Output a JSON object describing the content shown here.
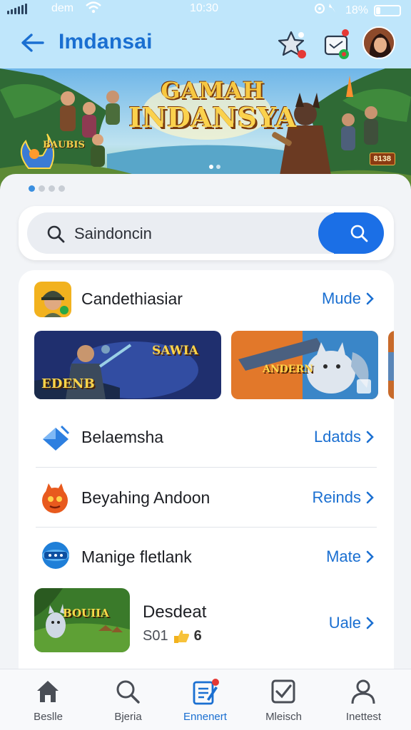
{
  "status_bar": {
    "carrier": "dem",
    "time": "10:30",
    "battery": "18%",
    "battery_level": 0.18
  },
  "header": {
    "title": "Imdansai",
    "icons": [
      "back-arrow-icon",
      "star-icon",
      "app-window-icon"
    ]
  },
  "banner": {
    "title_line1": "GAMAH",
    "title_line2": "INDANSYA",
    "left_label": "BAUBIS",
    "right_badge": "8138"
  },
  "carousel": {
    "total": 4,
    "active": 0
  },
  "search": {
    "value": "Saindoncin"
  },
  "sections": [
    {
      "label": "Candethiasiar",
      "link": "Mude",
      "icon": "soldier-app-icon"
    },
    {
      "label": "Belaemsha",
      "link": "Ldatds",
      "icon": "blue-diamond-icon"
    },
    {
      "label": "Beyahing Andoon",
      "link": "Reinds",
      "icon": "fire-creature-icon"
    },
    {
      "label": "Manige fletlank",
      "link": "Mate",
      "icon": "globe-badge-icon"
    }
  ],
  "thumbnails": [
    {
      "caption_top": "SAWIA",
      "caption_bottom": "EDENB"
    },
    {
      "caption": "ANDERN"
    }
  ],
  "featured": {
    "title": "Desdeat",
    "meta": "S01",
    "badge": "6",
    "link": "Uale",
    "thumb_caption": "BOUIIA"
  },
  "nav": {
    "active": 2,
    "items": [
      {
        "label": "Beslle",
        "icon": "home-icon"
      },
      {
        "label": "Bjeria",
        "icon": "search-icon"
      },
      {
        "label": "Ennenert",
        "icon": "edit-document-icon"
      },
      {
        "label": "Mleisch",
        "icon": "checkbox-icon"
      },
      {
        "label": "Inettest",
        "icon": "profile-icon"
      }
    ]
  },
  "colors": {
    "accent": "#1a6fd1",
    "header_bg": "#bfe6fb",
    "search_button": "#1b6fe6"
  }
}
